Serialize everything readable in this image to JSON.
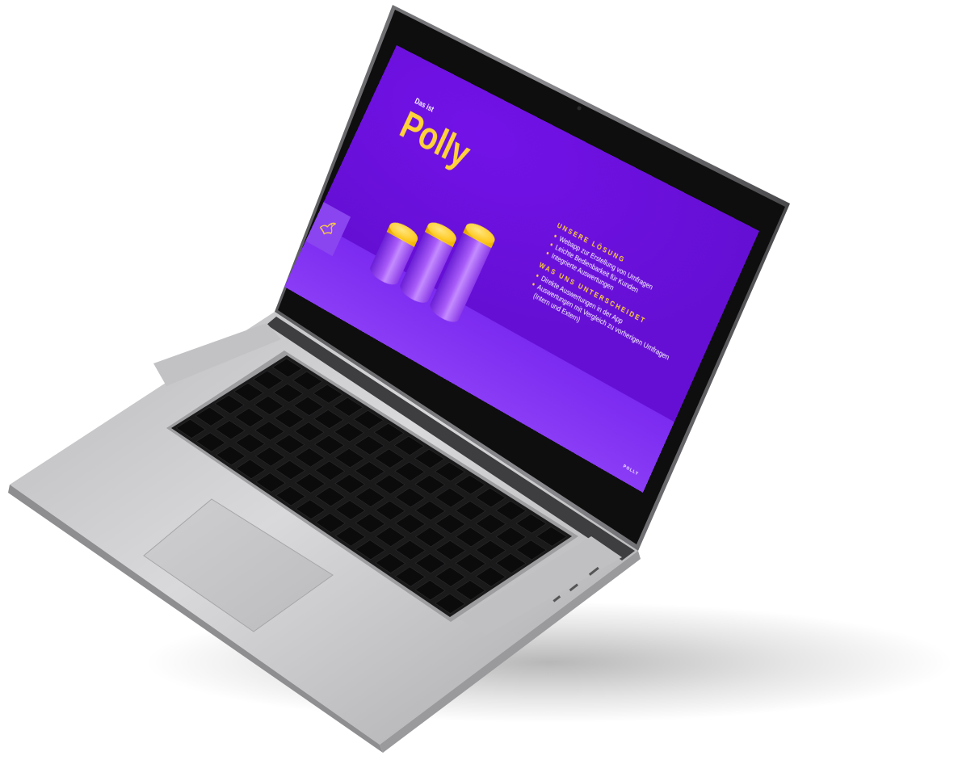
{
  "slide": {
    "intro": "Das ist",
    "brand": "Polly",
    "sections": [
      {
        "heading": "UNSERE LÖSUNG",
        "items": [
          "Webapp zur Erstellung von Umfragen",
          "Leichte Bedienbarkeit für Kunden",
          "Integrierte Auswertungen"
        ]
      },
      {
        "heading": "WAS UNS UNTERSCHEIDET",
        "items": [
          "Direkte Auswertungen in der App",
          "Auswertungen mit Vergleich zu vorherigen Umfragen (Intern und Extern)"
        ]
      }
    ],
    "footer": "POLLY"
  },
  "colors": {
    "slide_bg": "#6a10dd",
    "accent_yellow": "#ffd23a",
    "laptop_silver": "#c9c9cb",
    "bezel": "#0e0e0e"
  },
  "icons": [
    "bird-icon"
  ]
}
